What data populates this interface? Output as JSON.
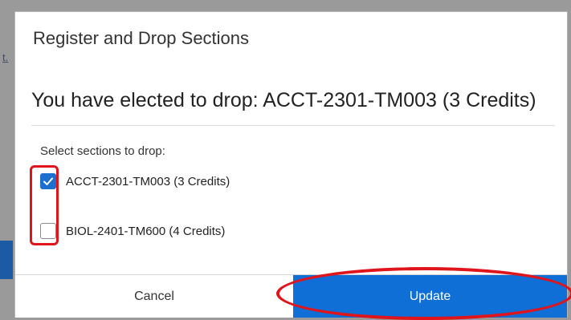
{
  "backdrop": {
    "link_text": "t."
  },
  "modal": {
    "title": "Register and Drop Sections",
    "drop_message": "You have elected to drop: ACCT-2301-TM003 (3 Credits)",
    "select_label": "Select sections to drop:",
    "sections": [
      {
        "label": "ACCT-2301-TM003 (3 Credits)",
        "checked": true
      },
      {
        "label": "BIOL-2401-TM600 (4 Credits)",
        "checked": false
      }
    ],
    "cancel_label": "Cancel",
    "update_label": "Update"
  },
  "colors": {
    "accent": "#0f6fd6",
    "checkbox_checked": "#1b6fcf",
    "annotation_red": "#e0141b"
  }
}
